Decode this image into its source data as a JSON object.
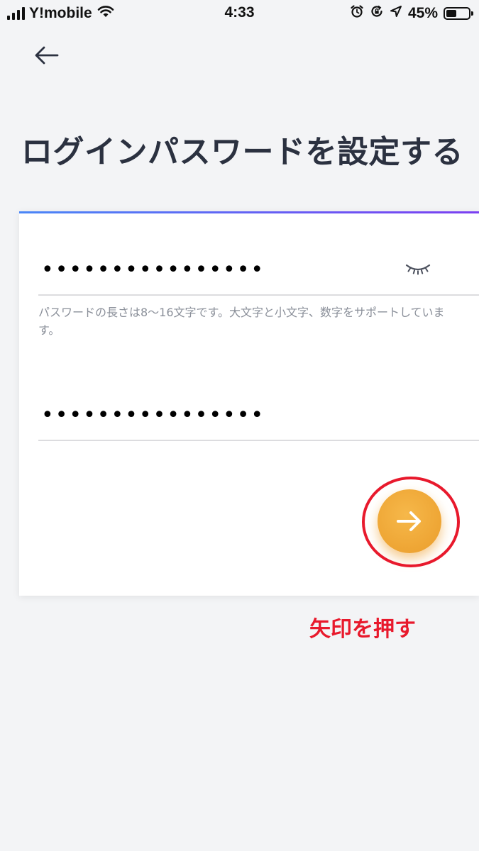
{
  "status_bar": {
    "carrier": "Y!mobile",
    "time": "4:33",
    "battery_percent": "45%",
    "battery_level": 0.45,
    "icons": [
      "signal-icon",
      "wifi-icon",
      "alarm-icon",
      "rotation-lock-icon",
      "location-icon",
      "battery-icon"
    ]
  },
  "header": {
    "back_icon": "arrow-left-icon",
    "title": "ログインパスワードを設定する"
  },
  "form": {
    "password": {
      "value": "••••••••••••••••",
      "toggle_icon": "eye-closed-icon"
    },
    "helper": "パスワードの長さは8〜16文字です。大文字と小文字、数字をサポートしています。",
    "confirm_password": {
      "value": "••••••••••••••••"
    },
    "next_icon": "arrow-right-icon"
  },
  "annotation": {
    "label": "矢印を押す",
    "color": "#e8192c"
  },
  "colors": {
    "accent_orange": "#f0a736",
    "title_text": "#2b3140",
    "helper_text": "#8a8f99",
    "background": "#f3f4f6",
    "card_top_gradient": [
      "#4a86f7",
      "#7b3ff2"
    ]
  }
}
